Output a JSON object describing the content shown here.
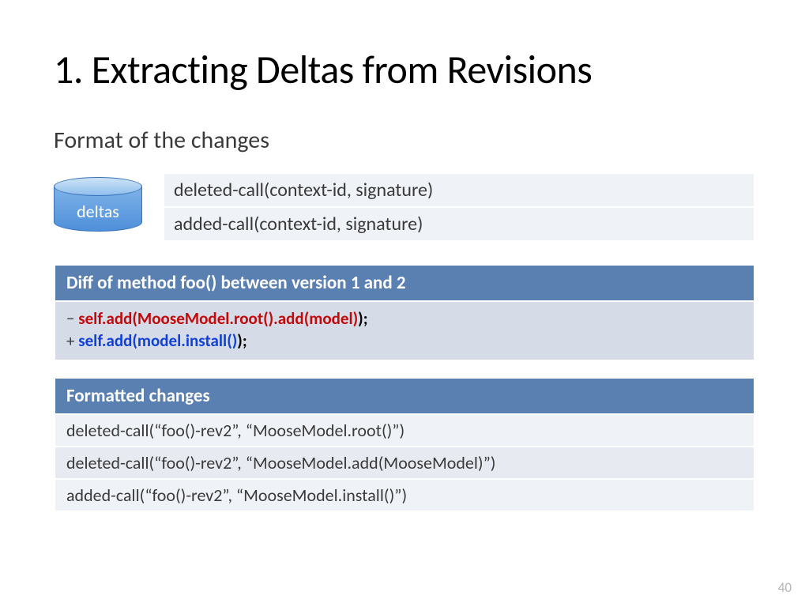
{
  "title": "1. Extracting Deltas from Revisions",
  "subtitle": "Format of the changes",
  "cylinder_label": "deltas",
  "format_rows": [
    "deleted-call(context-id, signature)",
    "added-call(context-id, signature)"
  ],
  "diff_panel": {
    "header": "Diff of method foo() between version 1 and 2",
    "removed_prefix": "− ",
    "removed_code": "self.add(MooseModel.root().add(model)",
    "removed_tail": ");",
    "added_prefix": "+ ",
    "added_code": "self.add(model.install()",
    "added_tail": ");"
  },
  "changes_panel": {
    "header": "Formatted changes",
    "rows": [
      "deleted-call(“foo()-rev2”, “MooseModel.root()”)",
      "deleted-call(“foo()-rev2”, “MooseModel.add(MooseModel)”)",
      "added-call(“foo()-rev2”, “MooseModel.install()”)"
    ]
  },
  "page_number": "40"
}
